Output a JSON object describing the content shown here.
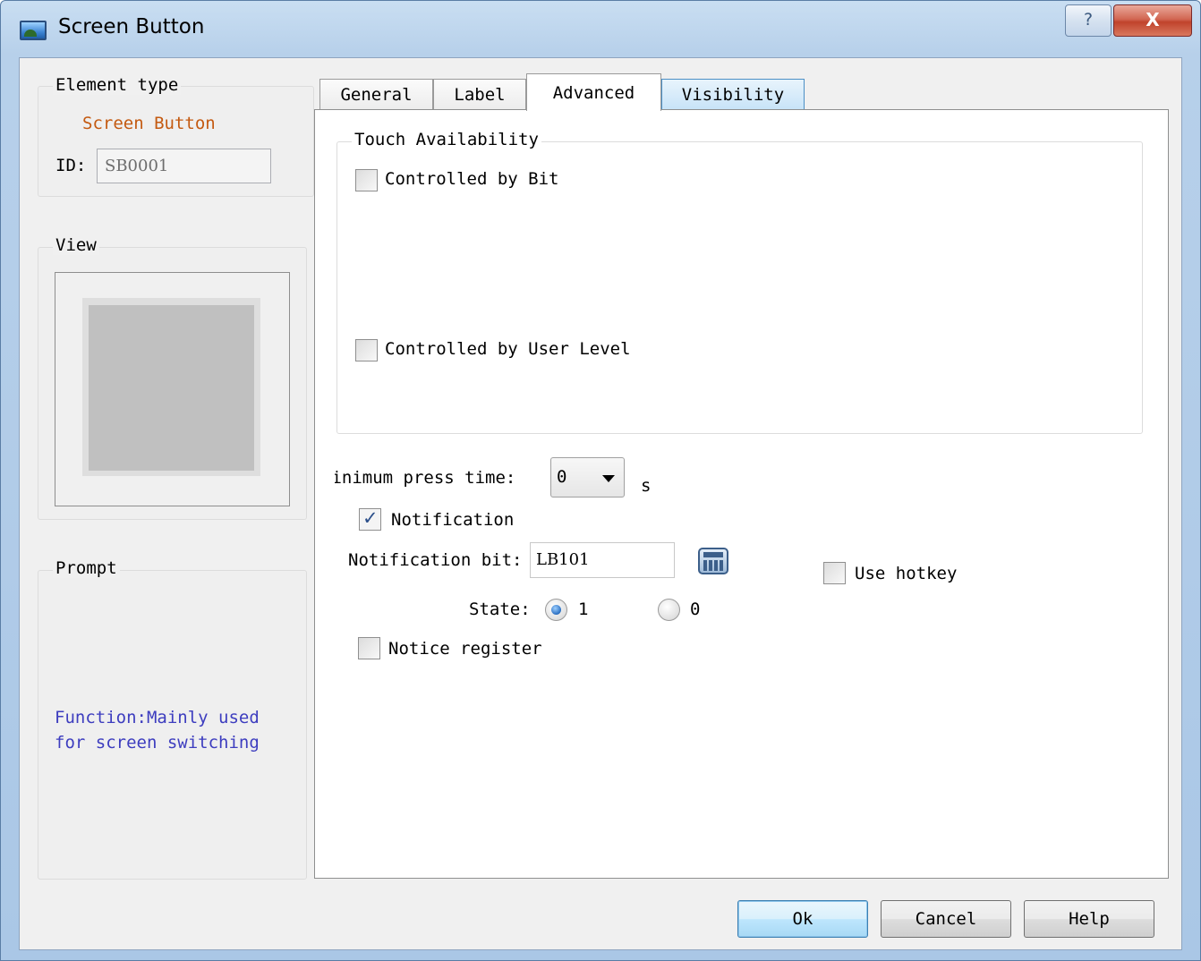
{
  "window": {
    "title": "Screen Button",
    "help_glyph": "?",
    "close_glyph": "X"
  },
  "element_type": {
    "group_title": "Element type",
    "value": "Screen Button",
    "id_label": "ID:",
    "id_value": "SB0001"
  },
  "view": {
    "group_title": "View"
  },
  "prompt": {
    "group_title": "Prompt",
    "text": "Function:Mainly used for screen switching"
  },
  "tabs": [
    {
      "label": "General"
    },
    {
      "label": "Label"
    },
    {
      "label": "Advanced"
    },
    {
      "label": "Visibility"
    }
  ],
  "active_tab": "Advanced",
  "touch": {
    "group_title": "Touch Availability",
    "controlled_by_bit": {
      "label": "Controlled by Bit",
      "checked": false
    },
    "controlled_by_user_level": {
      "label": "Controlled by User Level",
      "checked": false
    }
  },
  "min_press": {
    "label": "Minimum press time:",
    "value": "0",
    "unit": "s"
  },
  "notification": {
    "label": "Notification",
    "checked": true
  },
  "notification_bit": {
    "label": "Notification bit:",
    "value": "LB101"
  },
  "use_hotkey": {
    "label": "Use hotkey",
    "checked": false
  },
  "state": {
    "label": "State:",
    "option_1": "1",
    "option_0": "0",
    "selected": "1"
  },
  "notice_register": {
    "label": "Notice register",
    "checked": false
  },
  "buttons": {
    "ok": "Ok",
    "cancel": "Cancel",
    "help": "Help"
  },
  "colors": {
    "element_type_value": "#c45a11",
    "prompt_text": "#3d3dbf",
    "title_bar": "#b7d0ea",
    "close_button": "#c0432c"
  }
}
